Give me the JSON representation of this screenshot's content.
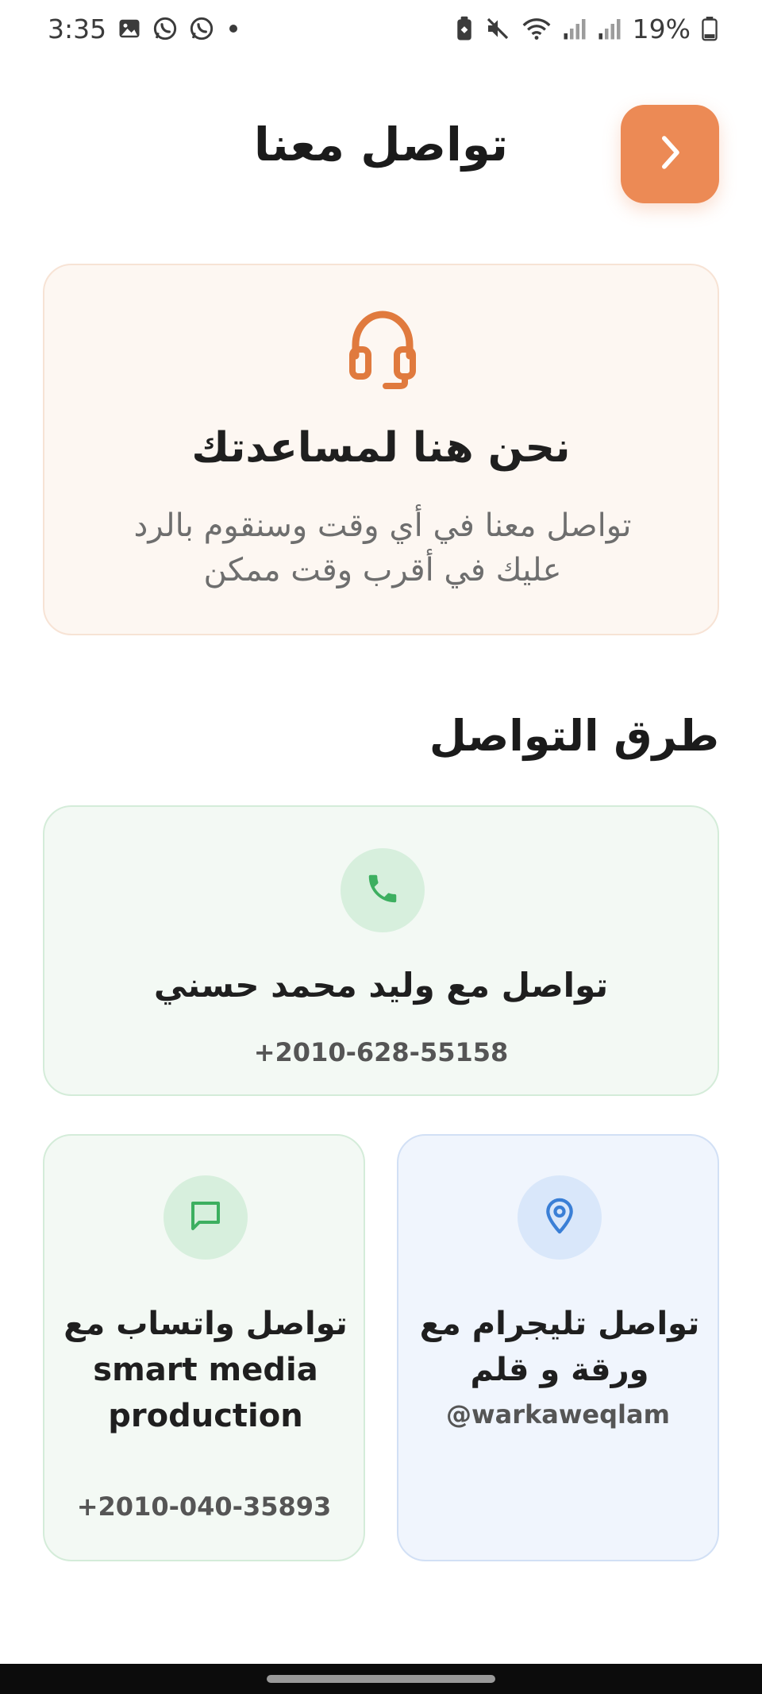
{
  "status_bar": {
    "time": "3:35",
    "battery": "19%",
    "left_icons": [
      "image-icon",
      "whatsapp-icon",
      "whatsapp-icon",
      "dot-icon"
    ],
    "right_icons": [
      "battery-saver-icon",
      "mute-icon",
      "wifi-icon",
      "signal-icon",
      "signal-icon"
    ]
  },
  "header": {
    "title": "تواصل معنا",
    "back_icon": "chevron-right-icon"
  },
  "help_card": {
    "icon": "headset-icon",
    "title": "نحن هنا لمساعدتك",
    "text": "تواصل معنا في أي وقت وسنقوم بالرد عليك في أقرب وقت ممكن"
  },
  "section_title": "طرق التواصل",
  "phone_card": {
    "icon": "phone-icon",
    "title": "تواصل مع وليد محمد حسني",
    "number": "+2010-628-55158"
  },
  "whatsapp_card": {
    "icon": "chat-icon",
    "title_ar": "تواصل واتساب مع",
    "title_en": "smart media production",
    "number": "+2010-040-35893"
  },
  "telegram_card": {
    "icon": "location-pin-icon",
    "title": "تواصل تليجرام مع ورقة و قلم",
    "handle": "@warkaweqlam"
  },
  "colors": {
    "accent": "#ec8a55",
    "accent_icon": "#e07a3e",
    "green": "#3daf60",
    "blue": "#3a7fd6",
    "help_bg": "#fdf7f2",
    "green_bg": "#f3f9f4",
    "blue_bg": "#f0f5fd"
  }
}
